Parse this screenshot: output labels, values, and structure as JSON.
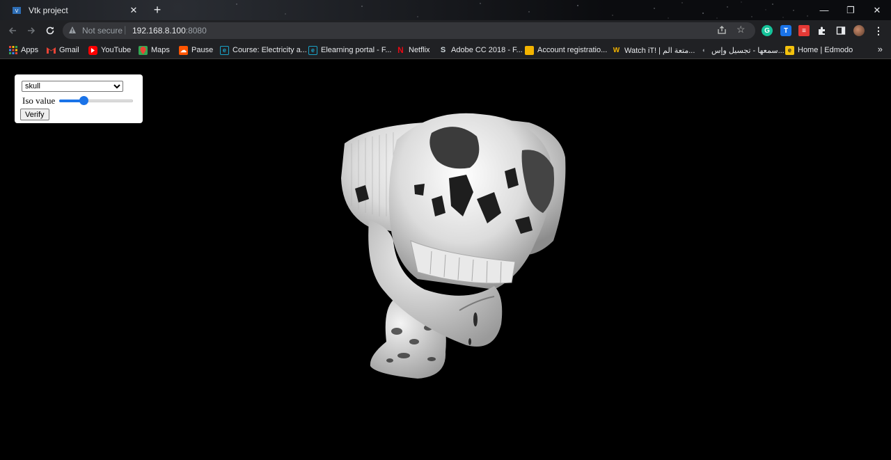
{
  "browser": {
    "tab_title": "Vtk project",
    "tab_close": "✕",
    "new_tab": "+",
    "address": {
      "security_label": "Not secure",
      "separator": "|",
      "host": "192.168.8.100",
      "port": ":8080"
    },
    "window_controls": {
      "minimize": "—",
      "restore": "❐",
      "close": "✕"
    }
  },
  "bookmarks": [
    {
      "label": "Apps",
      "icon": "apps-grid-icon",
      "color": "#ea4335"
    },
    {
      "label": "Gmail",
      "icon": "gmail-icon",
      "color": "#ea4335"
    },
    {
      "label": "YouTube",
      "icon": "youtube-icon",
      "color": "#ff0000"
    },
    {
      "label": "Maps",
      "icon": "maps-icon",
      "color": "#34a853"
    },
    {
      "label": "Pause",
      "icon": "soundcloud-icon",
      "color": "#ff5500"
    },
    {
      "label": "Course: Electricity a...",
      "icon": "moodle-icon",
      "color": "#1aa3c8"
    },
    {
      "label": "Elearning portal - F...",
      "icon": "moodle-icon",
      "color": "#1aa3c8"
    },
    {
      "label": "Netflix",
      "icon": "netflix-icon",
      "color": "#e50914"
    },
    {
      "label": "Adobe CC 2018 - F...",
      "icon": "s-logo-icon",
      "color": "#cfd8dc"
    },
    {
      "label": "Account registratio...",
      "icon": "folder-icon",
      "color": "#f4b400"
    },
    {
      "label": "Watch iT! | متعة الم...",
      "icon": "watchit-icon",
      "color": "#f4b400"
    },
    {
      "label": "سمعها - تجسيل وإس...",
      "icon": "speaker-icon",
      "color": "#5f6368"
    },
    {
      "label": "Home | Edmodo",
      "icon": "edmodo-icon",
      "color": "#f4c20d"
    }
  ],
  "bookmarks_more": "»",
  "controls": {
    "dataset_selected": "skull",
    "iso_label": "Iso value",
    "iso_fraction": 0.33,
    "verify_label": "Verify"
  },
  "accent": "#1a73e8"
}
